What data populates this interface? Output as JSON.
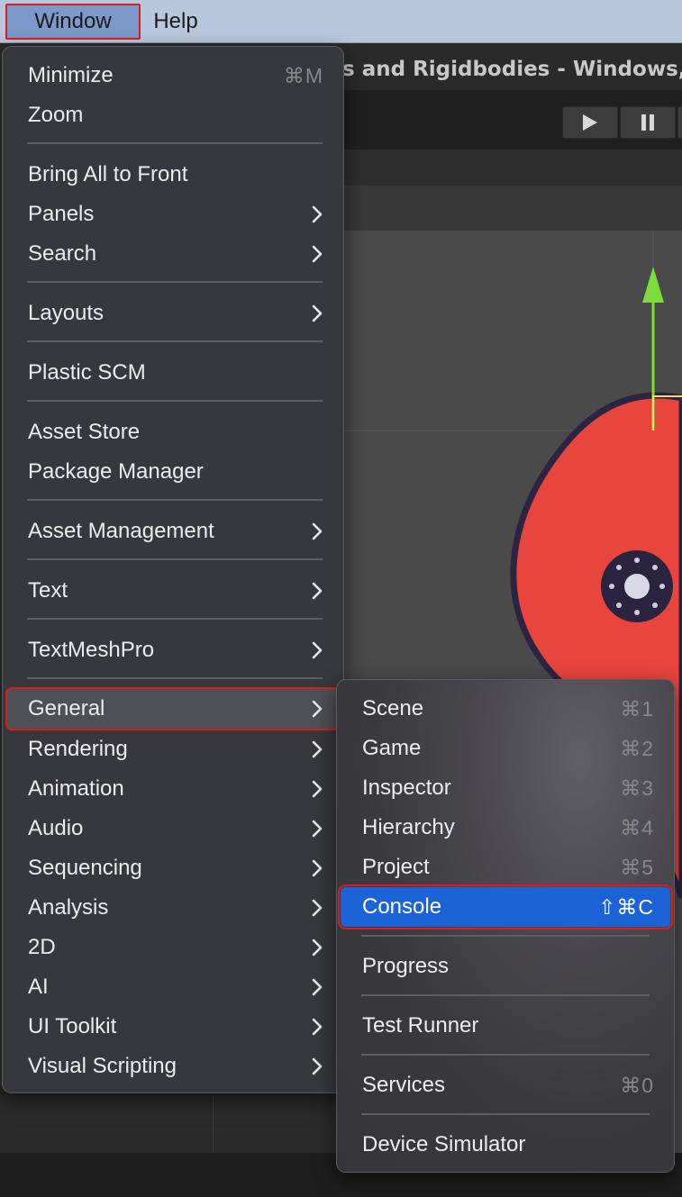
{
  "menubar": {
    "items": [
      "Window",
      "Help"
    ]
  },
  "editor": {
    "title_fragment": "s and Rigidbodies - Windows,"
  },
  "window_menu": {
    "items": [
      {
        "label": "Minimize",
        "shortcut": "⌘M"
      },
      {
        "label": "Zoom"
      },
      {
        "label": "Bring All to Front"
      },
      {
        "label": "Panels",
        "submenu": true
      },
      {
        "label": "Search",
        "submenu": true
      },
      {
        "label": "Layouts",
        "submenu": true
      },
      {
        "label": "Plastic SCM"
      },
      {
        "label": "Asset Store"
      },
      {
        "label": "Package Manager"
      },
      {
        "label": "Asset Management",
        "submenu": true
      },
      {
        "label": "Text",
        "submenu": true
      },
      {
        "label": "TextMeshPro",
        "submenu": true
      },
      {
        "label": "General",
        "submenu": true,
        "highlighted": true
      },
      {
        "label": "Rendering",
        "submenu": true
      },
      {
        "label": "Animation",
        "submenu": true
      },
      {
        "label": "Audio",
        "submenu": true
      },
      {
        "label": "Sequencing",
        "submenu": true
      },
      {
        "label": "Analysis",
        "submenu": true
      },
      {
        "label": "2D",
        "submenu": true
      },
      {
        "label": "AI",
        "submenu": true
      },
      {
        "label": "UI Toolkit",
        "submenu": true
      },
      {
        "label": "Visual Scripting",
        "submenu": true
      }
    ]
  },
  "general_submenu": {
    "items": [
      {
        "label": "Scene",
        "shortcut": "⌘1"
      },
      {
        "label": "Game",
        "shortcut": "⌘2"
      },
      {
        "label": "Inspector",
        "shortcut": "⌘3"
      },
      {
        "label": "Hierarchy",
        "shortcut": "⌘4"
      },
      {
        "label": "Project",
        "shortcut": "⌘5"
      },
      {
        "label": "Console",
        "shortcut": "⇧⌘C",
        "selected": true
      },
      {
        "label": "Progress"
      },
      {
        "label": "Test Runner"
      },
      {
        "label": "Services",
        "shortcut": "⌘0"
      },
      {
        "label": "Device Simulator"
      }
    ]
  },
  "colors": {
    "selection": "#1b63d6",
    "annotation_outline": "#d61f1f",
    "sprite_fill": "#e8453c",
    "gizmo_green": "#7ddc3a"
  }
}
